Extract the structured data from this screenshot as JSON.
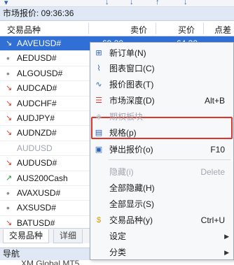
{
  "market_watch": {
    "title": "市场报价: 09:36:36",
    "columns": {
      "symbol": "交易品种",
      "bid": "卖价",
      "ask": "买价",
      "spread": "点差"
    },
    "selected_values": {
      "bid": "69.20",
      "ask": "64.30"
    },
    "rows": [
      {
        "symbol": "AAVEUSD#",
        "indicator": "down",
        "selected": true,
        "dim": false
      },
      {
        "symbol": "AEDUSD#",
        "indicator": "dot",
        "selected": false,
        "dim": false
      },
      {
        "symbol": "ALGOUSD#",
        "indicator": "dot",
        "selected": false,
        "dim": false
      },
      {
        "symbol": "AUDCAD#",
        "indicator": "down",
        "selected": false,
        "dim": false
      },
      {
        "symbol": "AUDCHF#",
        "indicator": "down",
        "selected": false,
        "dim": false
      },
      {
        "symbol": "AUDJPY#",
        "indicator": "down",
        "selected": false,
        "dim": false
      },
      {
        "symbol": "AUDNZD#",
        "indicator": "down",
        "selected": false,
        "dim": false
      },
      {
        "symbol": "AUDUSD",
        "indicator": "none",
        "selected": false,
        "dim": true
      },
      {
        "symbol": "AUDUSD#",
        "indicator": "down",
        "selected": false,
        "dim": false
      },
      {
        "symbol": "AUS200Cash",
        "indicator": "up",
        "selected": false,
        "dim": false
      },
      {
        "symbol": "AVAXUSD#",
        "indicator": "dot",
        "selected": false,
        "dim": false
      },
      {
        "symbol": "AXSUSD#",
        "indicator": "dot",
        "selected": false,
        "dim": false
      },
      {
        "symbol": "BATUSD#",
        "indicator": "down",
        "selected": false,
        "dim": false
      }
    ]
  },
  "tabs": [
    {
      "label": "交易品种",
      "active": true
    },
    {
      "label": "详细",
      "active": false
    }
  ],
  "navigator": {
    "title": "导航",
    "first_item": "XM Global MT5"
  },
  "context_menu": {
    "items": [
      {
        "label": "新订单(N)",
        "shortcut": "",
        "icon": "new-order-icon",
        "disabled": false,
        "submenu": false
      },
      {
        "label": "图表窗口(C)",
        "shortcut": "",
        "icon": "chart-window-icon",
        "disabled": false,
        "submenu": false
      },
      {
        "label": "报价图表(T)",
        "shortcut": "",
        "icon": "tick-chart-icon",
        "disabled": false,
        "submenu": false
      },
      {
        "label": "市场深度(D)",
        "shortcut": "Alt+B",
        "icon": "market-depth-icon",
        "disabled": false,
        "submenu": false
      },
      {
        "label": "期权板块",
        "shortcut": "",
        "icon": "option-board-icon",
        "disabled": true,
        "submenu": false
      },
      {
        "label": "规格(p)",
        "shortcut": "",
        "icon": "specification-icon",
        "disabled": false,
        "submenu": false
      },
      {
        "label": "弹出报价(o)",
        "shortcut": "F10",
        "icon": "popup-prices-icon",
        "disabled": false,
        "submenu": false
      },
      {
        "label": "隐藏(i)",
        "shortcut": "Delete",
        "icon": "",
        "disabled": true,
        "submenu": false
      },
      {
        "label": "全部隐藏(H)",
        "shortcut": "",
        "icon": "",
        "disabled": false,
        "submenu": false
      },
      {
        "label": "全部显示(S)",
        "shortcut": "",
        "icon": "",
        "disabled": false,
        "submenu": false
      },
      {
        "label": "交易品种(y)",
        "shortcut": "Ctrl+U",
        "icon": "symbols-icon",
        "disabled": false,
        "submenu": false
      },
      {
        "label": "设定",
        "shortcut": "",
        "icon": "",
        "disabled": false,
        "submenu": true
      },
      {
        "label": "分类",
        "shortcut": "",
        "icon": "",
        "disabled": false,
        "submenu": true
      }
    ]
  },
  "colors": {
    "selection": "#2f6fd6",
    "highlight_box": "#e0332b",
    "down": "#d23a2a",
    "up": "#1f9a3a"
  }
}
